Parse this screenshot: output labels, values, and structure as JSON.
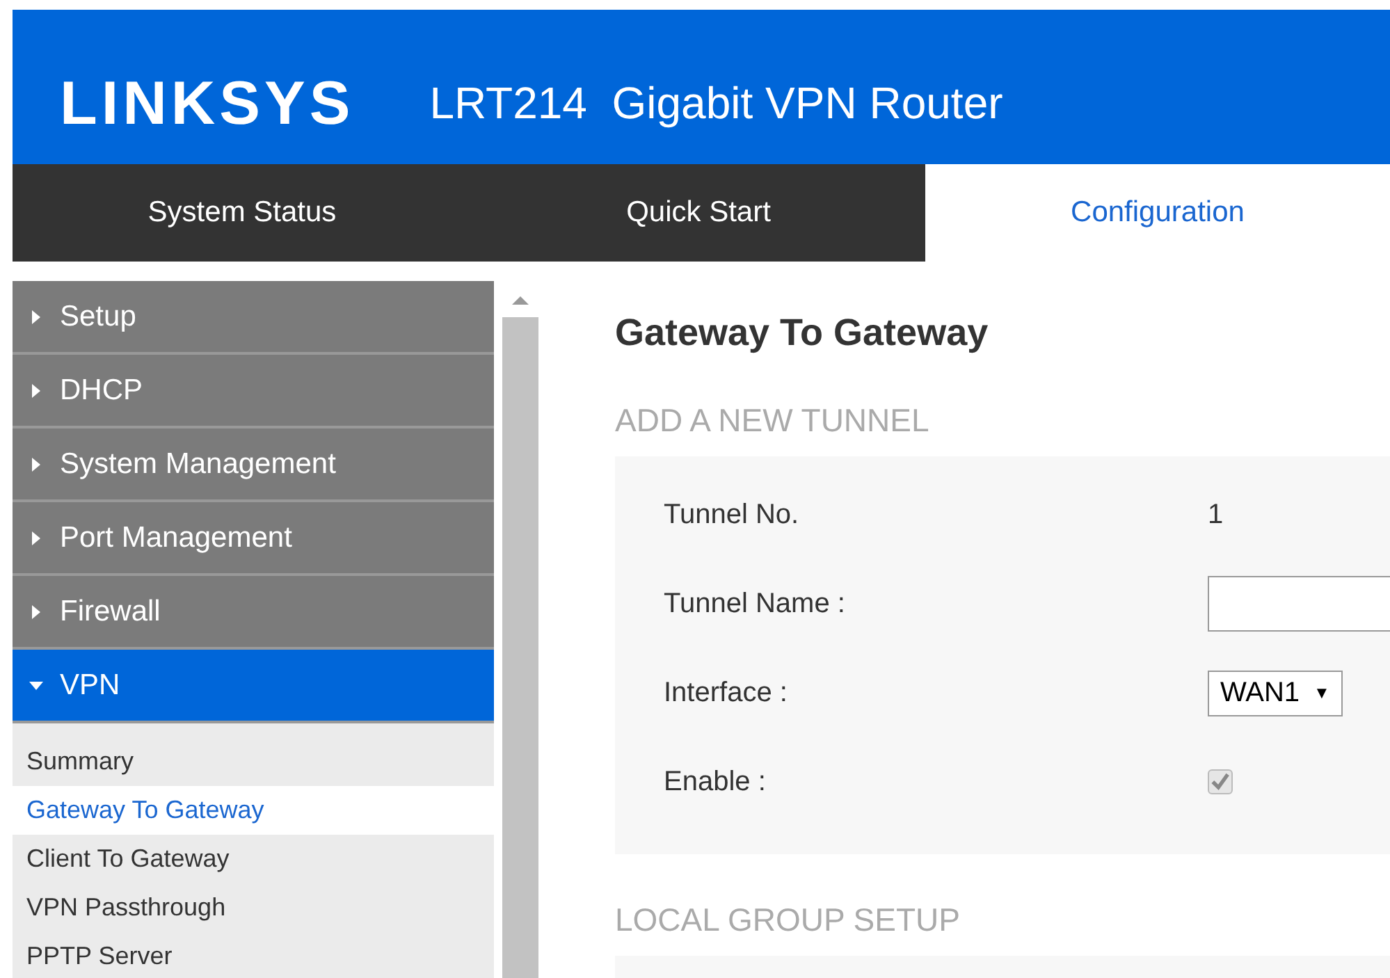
{
  "header": {
    "logo": "LINKSYS",
    "title": "LRT214  Gigabit VPN Router"
  },
  "tabs": [
    {
      "label": "System Status",
      "selected": false
    },
    {
      "label": "Quick Start",
      "selected": false
    },
    {
      "label": "Configuration",
      "selected": true
    }
  ],
  "sidebar": {
    "items": [
      {
        "label": "Setup",
        "expanded": false
      },
      {
        "label": "DHCP",
        "expanded": false
      },
      {
        "label": "System Management",
        "expanded": false
      },
      {
        "label": "Port Management",
        "expanded": false
      },
      {
        "label": "Firewall",
        "expanded": false
      },
      {
        "label": "VPN",
        "expanded": true,
        "children": [
          {
            "label": "Summary",
            "selected": false
          },
          {
            "label": "Gateway To Gateway",
            "selected": true
          },
          {
            "label": "Client To Gateway",
            "selected": false
          },
          {
            "label": "VPN Passthrough",
            "selected": false
          },
          {
            "label": "PPTP Server",
            "selected": false
          }
        ]
      }
    ]
  },
  "page": {
    "title": "Gateway To Gateway",
    "sections": [
      {
        "heading": "ADD A NEW TUNNEL",
        "fields": [
          {
            "kind": "text",
            "label": "Tunnel No.",
            "value": "1"
          },
          {
            "kind": "input",
            "label": "Tunnel Name :"
          },
          {
            "kind": "select",
            "label": "Interface :",
            "value": "WAN1",
            "caret": "▼"
          },
          {
            "kind": "checkbox",
            "label": "Enable :",
            "checked": true,
            "disabled": true
          }
        ]
      },
      {
        "heading": "LOCAL GROUP SETUP"
      }
    ]
  }
}
